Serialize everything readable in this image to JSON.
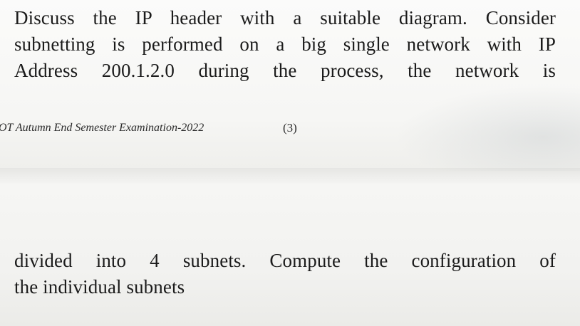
{
  "question": {
    "lines": [
      "Discuss the IP header with a suitable diagram. Consider",
      "subnetting is performed on a big single network with IP",
      "Address 200.1.2.0 during the process, the network is"
    ]
  },
  "footer": {
    "exam_text": "OT Autumn End Semester Examination-2022",
    "page_number": "(3)"
  },
  "continuation": {
    "lines": [
      "divided into 4 subnets. Compute the configuration of",
      "the individual subnets"
    ]
  }
}
